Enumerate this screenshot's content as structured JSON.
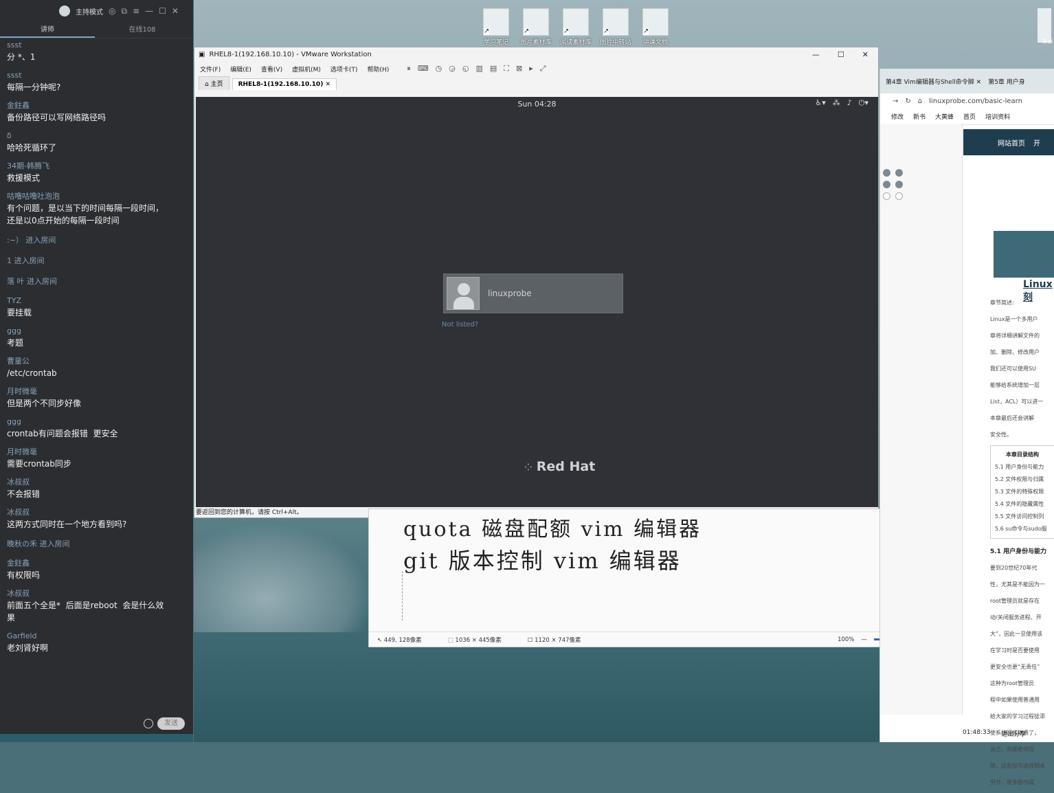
{
  "desktop": {
    "icons": [
      "学习笔记",
      "图片素材库",
      "阅读素材库",
      "图片中转站",
      "讲课文档"
    ],
    "right_label": "Bai"
  },
  "chat": {
    "header_title": "主持模式",
    "tab_chat": "讲师",
    "tab_online": "在线108",
    "messages": [
      {
        "name": "ssst",
        "text": "分 *、1"
      },
      {
        "name": "ssst",
        "text": "每隔一分钟呢?"
      },
      {
        "name": "金鉒鑫",
        "text": "备份路径可以写网络路径吗"
      },
      {
        "name": "δ",
        "text": "哈哈死循环了"
      },
      {
        "name": "34期-韩腾飞",
        "text": "救援模式"
      },
      {
        "name": "咕噜咕噜吐泡泡",
        "text": "有个问题，是以当下的时间每隔一段时间，\n还是以0点开始的每隔一段时间"
      },
      {
        "system": ":~）  进入房间"
      },
      {
        "system": "1 进入房间"
      },
      {
        "system": "落    叶  进入房间"
      },
      {
        "name": "TYZ",
        "text": "要挂载"
      },
      {
        "name": "ggg",
        "text": "考题"
      },
      {
        "name": "曹童公",
        "text": "/etc/crontab"
      },
      {
        "name": "月时微毫",
        "text": "但是两个不同步好像"
      },
      {
        "name": "ggg",
        "text": "crontab有问题会报错  更安全"
      },
      {
        "name": "月时微毫",
        "text": "需要crontab同步"
      },
      {
        "name": "冰叔叔",
        "text": "不会报错"
      },
      {
        "name": "冰叔叔",
        "text": "这两方式同时在一个地方看到吗?"
      },
      {
        "system": "晚秋の禾  进入房间"
      },
      {
        "name": "金鉒鑫",
        "text": "有权限吗"
      },
      {
        "name": "冰叔叔",
        "text": "前面五个全是*  后面是reboot  会是什么效\n果"
      },
      {
        "name": "Garfield",
        "text": "老刘肾好啊"
      }
    ],
    "send_label": "发送"
  },
  "vmware": {
    "title": "RHEL8-1(192.168.10.10) - VMware Workstation",
    "menu": [
      "文件(F)",
      "编辑(E)",
      "查看(V)",
      "虚拟机(M)",
      "选项卡(T)",
      "帮助(H)"
    ],
    "tab_home": "主页",
    "tab_vm": "RHEL8-1(192.168.10.10)",
    "clock": "Sun 04:28",
    "username": "linuxprobe",
    "not_listed": "Not listed?",
    "brand": "Red Hat",
    "status": "要返回到您的计算机，请按 Ctrl+Alt。"
  },
  "viewer": {
    "line1": "quota 磁盘配额 vim 编辑器",
    "line2": "git 版本控制 vim 编辑器",
    "cursor_pos": "449, 128像素",
    "selection": "1036 × 445像素",
    "image_size": "1120 × 747像素",
    "zoom": "100%",
    "zoom_level": 0.4
  },
  "browser": {
    "tab1": "第4章 Vim编辑器与Shell命令脚",
    "tab2": "第5章 用户身",
    "address": "linuxprobe.com/basic-learn",
    "bookmarks": [
      "修改",
      "新书",
      "大黄蜂",
      "首页",
      "培训资料"
    ],
    "site_nav": [
      "网站首页",
      "开"
    ],
    "page_title": "Linux刻",
    "intro_label": "章节简述:",
    "paragraphs": [
      "Linux是一个多用户",
      "章将详细讲解文件的",
      "加、删除、修改用户",
      "我们还可以使用SU",
      "能够给系统增加一层",
      "List，ACL）可以进一",
      "本章最后还会讲解",
      "安全性。"
    ],
    "toc_title": "本章目录结构",
    "toc": [
      "5.1 用户身份与能力",
      "5.2 文件权限与归属",
      "5.3 文件的特殊权限",
      "5.4 文件的隐藏属性",
      "5.5 文件访问控制列",
      "5.6 su命令与sudo服"
    ],
    "section": "5.1 用户身份与能力",
    "section_text": [
      "要到20世纪70年代",
      "性，尤其是不能因为一",
      "root管理员就是存在",
      "动/关闭服务进程、开",
      "大”，因此一旦使用该",
      "在学习时是否要使用",
      "更安全也更“无责任”",
      "这种为root管理员",
      "程中如果使用普通用",
      "给大家的学习过程徒添",
      "使系统彻底崩溃了，",
      "总之，刘遄老师在",
      "限，这些仅与选择相关",
      "另外，很多图书或"
    ],
    "footer_time": "01:48:33",
    "footer_share": "退出分享"
  }
}
